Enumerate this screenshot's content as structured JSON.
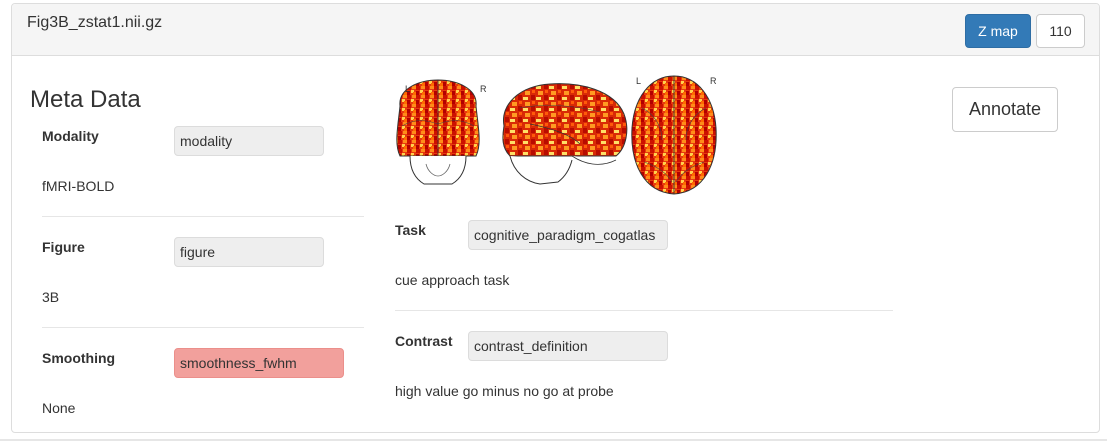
{
  "header": {
    "file_name": "Fig3B_zstat1.nii.gz",
    "map_type_button": "Z map",
    "count_button": "110"
  },
  "meta": {
    "heading": "Meta Data",
    "modality": {
      "label": "Modality",
      "input_value": "modality",
      "value": "fMRI-BOLD"
    },
    "figure": {
      "label": "Figure",
      "input_value": "figure",
      "value": "3B"
    },
    "smoothing": {
      "label": "Smoothing",
      "input_value": "smoothness_fwhm",
      "value": "None"
    }
  },
  "brain": {
    "coronal_left": "L",
    "coronal_right": "R",
    "axial_left": "L",
    "axial_right": "R"
  },
  "task": {
    "label": "Task",
    "input_value": "cognitive_paradigm_cogatlas",
    "value": "cue approach task"
  },
  "contrast": {
    "label": "Contrast",
    "input_value": "contrast_definition",
    "value": "high value go minus no go at probe"
  },
  "annotate_button": "Annotate",
  "colors": {
    "primary": "#337ab7",
    "error_field": "#f2a09c",
    "heat_dark": "#cc1100",
    "heat_light": "#ffe066"
  }
}
